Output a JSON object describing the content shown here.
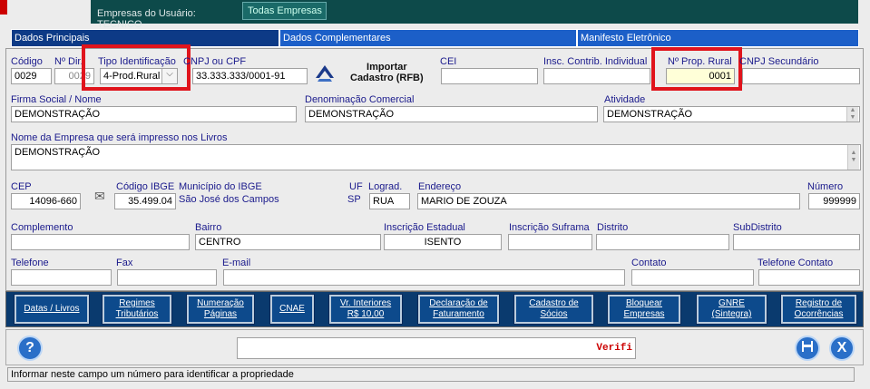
{
  "top": {
    "tab1": "Empresas do Usuário: TECNICO",
    "tab2": "Todas Empresas"
  },
  "tabs": [
    {
      "label": "Dados Principais"
    },
    {
      "label": "Dados Complementares"
    },
    {
      "label": "Manifesto Eletrônico"
    }
  ],
  "fields": {
    "codigo": {
      "label": "Código",
      "value": "0029"
    },
    "ndir": {
      "label": "Nº Dir.",
      "value": "0029"
    },
    "tipo": {
      "label": "Tipo Identificação",
      "value": "4-Prod.Rural"
    },
    "cnpj": {
      "label": "CNPJ ou CPF",
      "value": "33.333.333/0001-91"
    },
    "importar": {
      "label1": "Importar",
      "label2": "Cadastro (RFB)"
    },
    "cei": {
      "label": "CEI",
      "value": ""
    },
    "insc_contrib": {
      "label": "Insc. Contrib. Individual",
      "value": ""
    },
    "prop_rural": {
      "label": "Nº Prop. Rural",
      "value": "0001"
    },
    "cnpj_sec": {
      "label": "CNPJ Secundário",
      "value": ""
    },
    "firma": {
      "label": "Firma Social / Nome",
      "value": "DEMONSTRAÇÃO"
    },
    "denominacao": {
      "label": "Denominação Comercial",
      "value": "DEMONSTRAÇÃO"
    },
    "atividade": {
      "label": "Atividade",
      "value": "DEMONSTRAÇÃO"
    },
    "nome_livros": {
      "label": "Nome da Empresa que será impresso nos Livros",
      "value": "DEMONSTRAÇÃO"
    },
    "cep": {
      "label": "CEP",
      "value": "14096-660"
    },
    "ibge": {
      "label": "Código IBGE",
      "value": "35.499.04"
    },
    "municipio": {
      "label": "Município do IBGE",
      "value": "São José dos Campos"
    },
    "uf": {
      "label": "UF",
      "value": "SP"
    },
    "lograd": {
      "label": "Lograd.",
      "value": "RUA"
    },
    "endereco": {
      "label": "Endereço",
      "value": "MARIO DE ZOUZA"
    },
    "numero": {
      "label": "Número",
      "value": "999999"
    },
    "complemento": {
      "label": "Complemento",
      "value": ""
    },
    "bairro": {
      "label": "Bairro",
      "value": "CENTRO"
    },
    "insc_estadual": {
      "label": "Inscrição Estadual",
      "value": "ISENTO"
    },
    "insc_suframa": {
      "label": "Inscrição Suframa",
      "value": ""
    },
    "distrito": {
      "label": "Distrito",
      "value": ""
    },
    "subdistrito": {
      "label": "SubDistrito",
      "value": ""
    },
    "telefone": {
      "label": "Telefone",
      "value": ""
    },
    "fax": {
      "label": "Fax",
      "value": ""
    },
    "email": {
      "label": "E-mail",
      "value": ""
    },
    "contato": {
      "label": "Contato",
      "value": ""
    },
    "tel_contato": {
      "label": "Telefone Contato",
      "value": ""
    }
  },
  "buttons": [
    {
      "l1": "Datas / Livros",
      "l2": ""
    },
    {
      "l1": "Regimes",
      "l2": "Tributários"
    },
    {
      "l1": "Numeração",
      "l2": "Páginas"
    },
    {
      "l1": "CNAE",
      "l2": ""
    },
    {
      "l1": "Vr. Interiores",
      "l2": "R$ 10,00"
    },
    {
      "l1": "Declaração de",
      "l2": "Faturamento"
    },
    {
      "l1": "Cadastro de",
      "l2": "Sócios"
    },
    {
      "l1": "Bloquear",
      "l2": "Empresas"
    },
    {
      "l1": "GNRE",
      "l2": "(Sintegra)"
    },
    {
      "l1": "Registro de",
      "l2": "Ocorrências"
    }
  ],
  "bottom": {
    "help": "?",
    "message": "Verifi",
    "save_icon": "save-icon",
    "close": "X"
  },
  "status": "Informar neste campo um número para identificar a propriedade"
}
